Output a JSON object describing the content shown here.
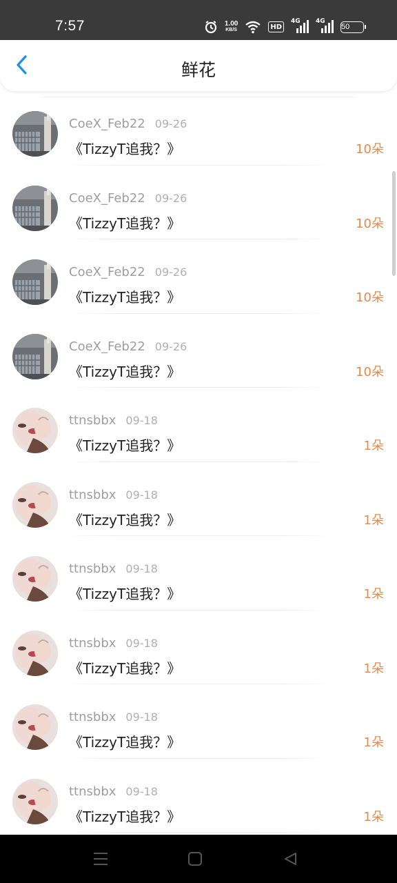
{
  "status_bar": {
    "time": "7:57",
    "net_speed_value": "1.00",
    "net_speed_unit": "KB/S",
    "hd_label": "HD",
    "signal1_label": "4G",
    "signal2_label": "4G",
    "battery": "50"
  },
  "header": {
    "title": "鲜花"
  },
  "colors": {
    "accent_back": "#1e8fe6",
    "count_orange": "#e8894a"
  },
  "items": [
    {
      "user": "CoeX_Feb22",
      "date": "09-26",
      "title": "《TizzyT追我？》",
      "count": "10朵",
      "avatar": "building"
    },
    {
      "user": "CoeX_Feb22",
      "date": "09-26",
      "title": "《TizzyT追我？》",
      "count": "10朵",
      "avatar": "building"
    },
    {
      "user": "CoeX_Feb22",
      "date": "09-26",
      "title": "《TizzyT追我？》",
      "count": "10朵",
      "avatar": "building"
    },
    {
      "user": "CoeX_Feb22",
      "date": "09-26",
      "title": "《TizzyT追我？》",
      "count": "10朵",
      "avatar": "building"
    },
    {
      "user": "ttnsbbx",
      "date": "09-18",
      "title": "《TizzyT追我？》",
      "count": "1朵",
      "avatar": "person"
    },
    {
      "user": "ttnsbbx",
      "date": "09-18",
      "title": "《TizzyT追我？》",
      "count": "1朵",
      "avatar": "person"
    },
    {
      "user": "ttnsbbx",
      "date": "09-18",
      "title": "《TizzyT追我？》",
      "count": "1朵",
      "avatar": "person"
    },
    {
      "user": "ttnsbbx",
      "date": "09-18",
      "title": "《TizzyT追我？》",
      "count": "1朵",
      "avatar": "person"
    },
    {
      "user": "ttnsbbx",
      "date": "09-18",
      "title": "《TizzyT追我？》",
      "count": "1朵",
      "avatar": "person"
    },
    {
      "user": "ttnsbbx",
      "date": "09-18",
      "title": "《TizzyT追我？》",
      "count": "1朵",
      "avatar": "person"
    }
  ],
  "icons": {
    "back": "chevron-left-icon",
    "alarm": "alarm-icon",
    "wifi": "wifi-icon",
    "menu": "menu-icon",
    "home": "square-home-icon",
    "back_nav": "triangle-back-icon"
  }
}
